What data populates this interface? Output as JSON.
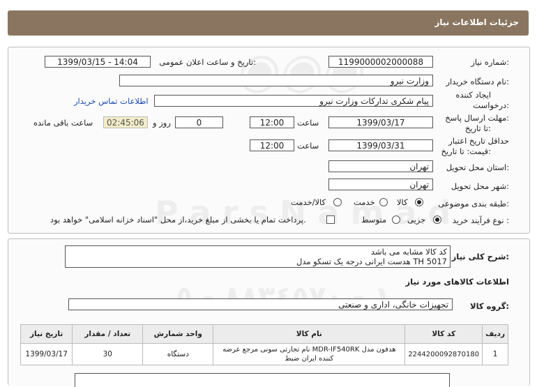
{
  "header": {
    "title": "جزئیات اطلاعات نیاز"
  },
  "form": {
    "need_number_label": "شماره نیاز:",
    "need_number": "1199000002000088",
    "announce_label": "تاریخ و ساعت اعلان عمومی:",
    "announce_value": "1399/03/15 - 14:04",
    "buyer_org_label": "نام دستگاه خریدار:",
    "buyer_org": "وزارت نیرو",
    "requester_label_1": "ایجاد کننده",
    "requester_label_2": "درخواست:",
    "requester": "پیام شکری تدارکات وزارت نیرو",
    "contact_link": "اطلاعات تماس خریدار",
    "deadline_label_1": "مهلت ارسال پاسخ:",
    "deadline_label_2": "تا تاریخ:",
    "deadline_date": "1399/03/17",
    "time_label": "ساعت",
    "deadline_time": "12:00",
    "days_value": "0",
    "days_label": "روز و",
    "remaining_time": "02:45:06",
    "remaining_label": "ساعت باقی مانده",
    "validity_label_1": "حداقل تاریخ اعتبار",
    "validity_label_2": "قیمت: تا تاریخ:",
    "validity_date": "1399/03/31",
    "validity_time": "12:00",
    "province_label": "استان محل تحویل:",
    "province": "تهران",
    "city_label": "شهر محل تحویل:",
    "city": "تهران",
    "category_label": "طبقه بندی موضوعی:",
    "category_options": [
      "کالا",
      "خدمت",
      "کالا/خدمت"
    ],
    "purchase_type_label": "نوع فرآیند خرید :",
    "purchase_options": [
      "جزیی",
      "متوسط"
    ],
    "payment_note": "پرداخت تمام یا بخشی از مبلغ خرید،از محل \"اسناد خزانه اسلامی\" خواهد بود."
  },
  "summary": {
    "label": "شرح کلی نیاز:",
    "line1": "کد کالا مشابه می باشد",
    "line2": "هدست ایرانی درجه یک تسکو مدل TH 5017"
  },
  "goods": {
    "section_title": "اطلاعات کالاهای مورد نیاز",
    "group_label": "گروه کالا:",
    "group_value": "تجهیزات خانگی، اداری و صنعتی"
  },
  "table": {
    "headers": [
      "ردیف",
      "کد کالا",
      "نام کالا",
      "واحد شمارش",
      "تعداد / مقدار",
      "تاریخ نیاز"
    ],
    "rows": [
      {
        "index": "1",
        "code": "2244200092870180",
        "name": "هدفون مدل MDR-IF540RK نام تجارتی سونی مرجع عرضه کننده ایران ضبط",
        "unit": "دستگاه",
        "qty": "30",
        "date": "1399/03/17"
      }
    ]
  },
  "colors": {
    "header_bg": "#8a7660",
    "link": "#1a4bb0",
    "remaining_bg": "#f2ecc8"
  }
}
